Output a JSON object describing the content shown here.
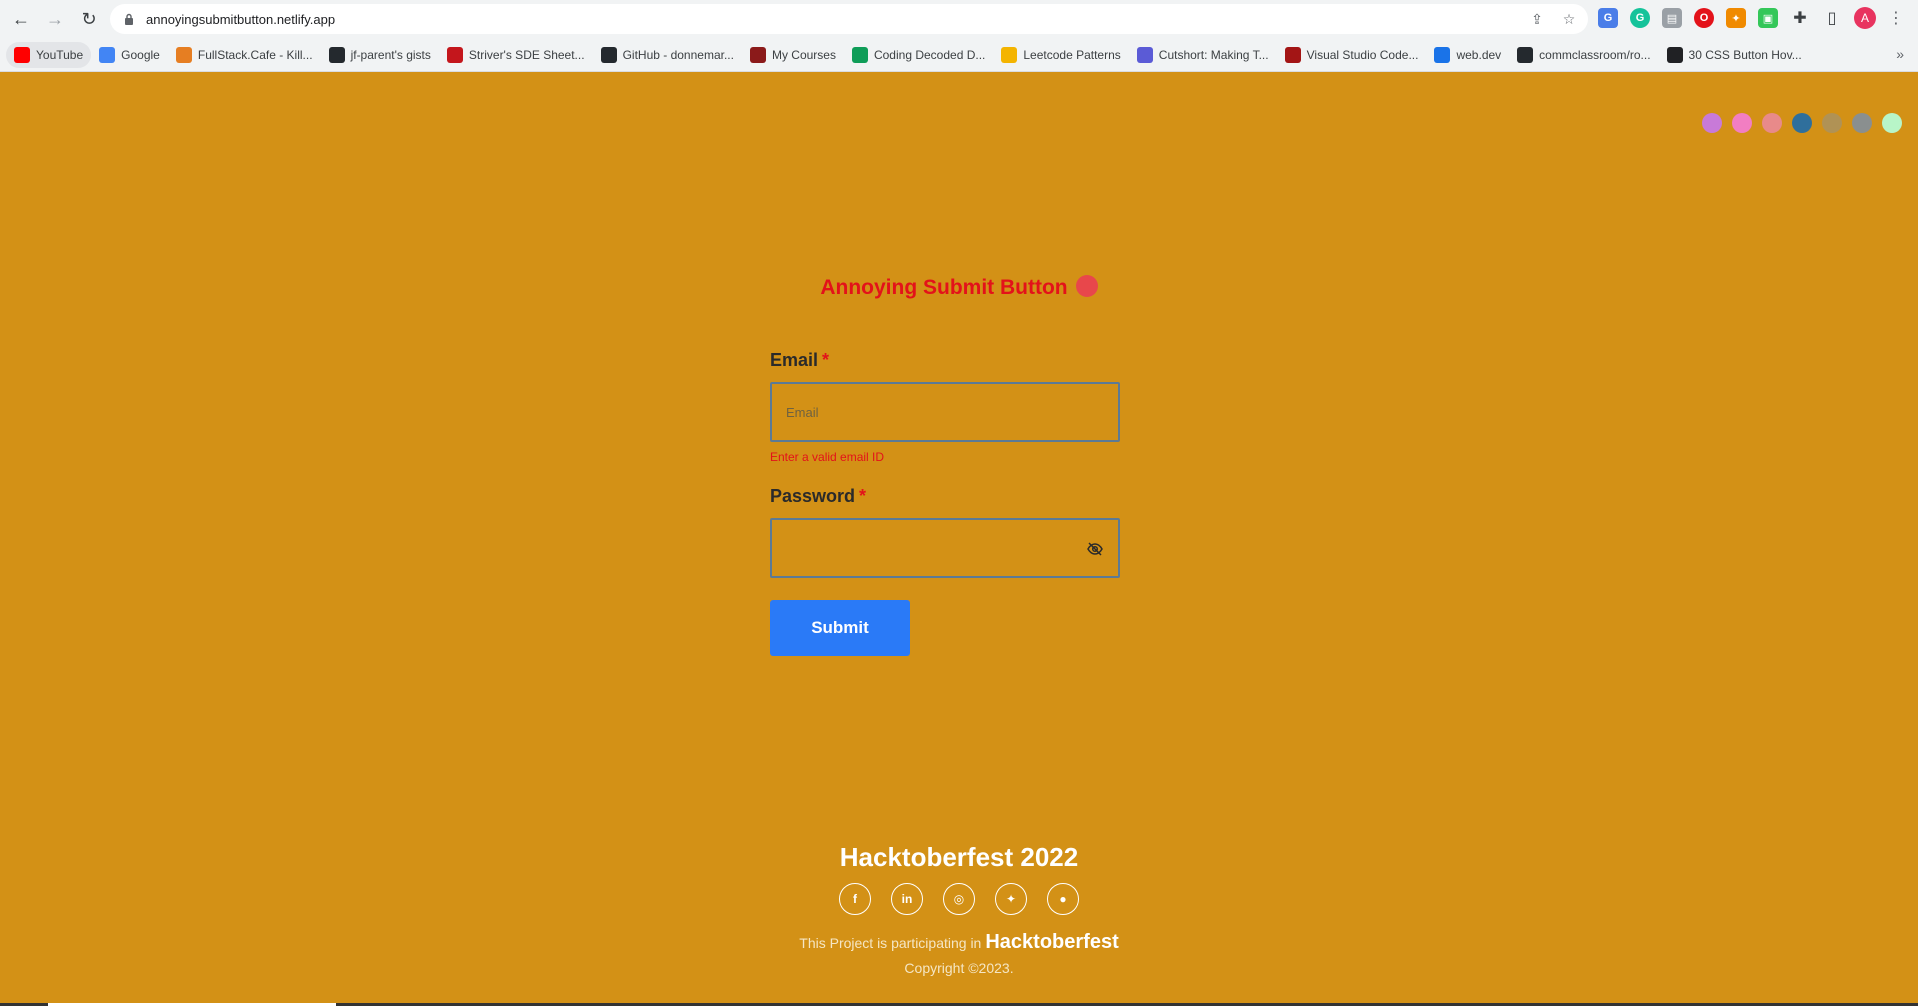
{
  "browser": {
    "url": "annoyingsubmitbutton.netlify.app",
    "profile_initial": "A",
    "bookmarks": [
      {
        "label": "YouTube",
        "color": "#ff0000"
      },
      {
        "label": "Google",
        "color": "#4285f4"
      },
      {
        "label": "FullStack.Cafe - Kill...",
        "color": "#e67e22"
      },
      {
        "label": "jf-parent's gists",
        "color": "#24292e"
      },
      {
        "label": "Striver's SDE Sheet...",
        "color": "#c4161c"
      },
      {
        "label": "GitHub - donnemar...",
        "color": "#24292e"
      },
      {
        "label": "My Courses",
        "color": "#8b1a1a"
      },
      {
        "label": "Coding Decoded D...",
        "color": "#0f9d58"
      },
      {
        "label": "Leetcode Patterns",
        "color": "#f4b400"
      },
      {
        "label": "Cutshort: Making T...",
        "color": "#5b5bd6"
      },
      {
        "label": "Visual Studio Code...",
        "color": "#a31515"
      },
      {
        "label": "web.dev",
        "color": "#1a73e8"
      },
      {
        "label": "commclassroom/ro...",
        "color": "#24292e"
      },
      {
        "label": "30 CSS Button Hov...",
        "color": "#202124"
      }
    ]
  },
  "theme_dots": [
    "#c87ad8",
    "#f27ec2",
    "#e88a8a",
    "#2f6f9c",
    "#b09255",
    "#8a8f8f",
    "#b8f5c8"
  ],
  "page": {
    "title": "Annoying Submit Button",
    "email_label": "Email",
    "email_required": "*",
    "email_placeholder": "Email",
    "email_error": "Enter a valid email ID",
    "password_label": "Password",
    "password_required": "*",
    "submit_label": "Submit"
  },
  "footer": {
    "title": "Hacktoberfest 2022",
    "socials": [
      "facebook",
      "linkedin",
      "instagram",
      "twitter",
      "github"
    ],
    "participating_text": "This Project is participating in",
    "brand": "Hacktoberfest",
    "copyright": "Copyright ©2023."
  }
}
